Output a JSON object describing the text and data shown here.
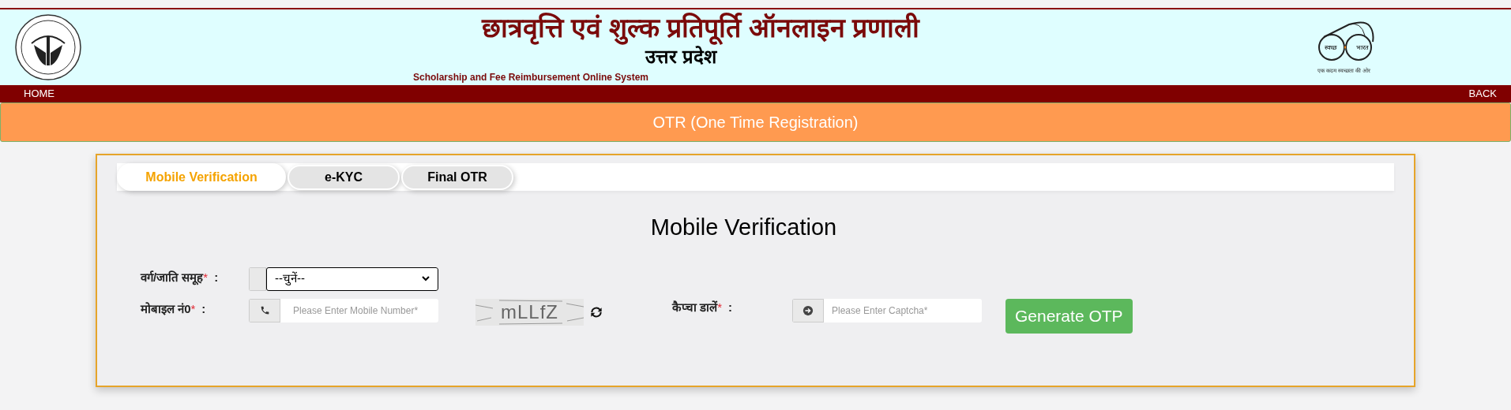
{
  "header": {
    "title": "छात्रवृत्ति एवं शुल्क प्रतिपूर्ति ऑनलाइन प्रणाली",
    "state": "उत्तर प्रदेश",
    "subtitle": "Scholarship and Fee Reimbursement Online System",
    "logo_right": {
      "word_1": "स्वच्छ",
      "word_2": "भारत",
      "tagline": "एक कदम स्वच्छता की ओर"
    }
  },
  "nav": {
    "left": "HOME",
    "right": "BACK"
  },
  "banner": "OTR (One Time Registration)",
  "tabs": [
    {
      "label": "Mobile Verification",
      "selected": true
    },
    {
      "label": "e-KYC",
      "selected": false
    },
    {
      "label": "Final OTR",
      "selected": false
    }
  ],
  "form": {
    "heading": "Mobile Verification",
    "category": {
      "label": "वर्ग/जाति समूह",
      "required": "*",
      "colon": ":",
      "value": "--चुनें--"
    },
    "mobile": {
      "label": "मोबाइल नं0",
      "required": "*",
      "colon": ":",
      "placeholder": "Please Enter Mobile Number*"
    },
    "captcha_image": "mLLfZ",
    "captcha": {
      "label": "कैप्चा डालें",
      "required": "*",
      "colon": ":",
      "placeholder": "Please Enter Captcha*"
    },
    "button": "Generate OTP"
  }
}
